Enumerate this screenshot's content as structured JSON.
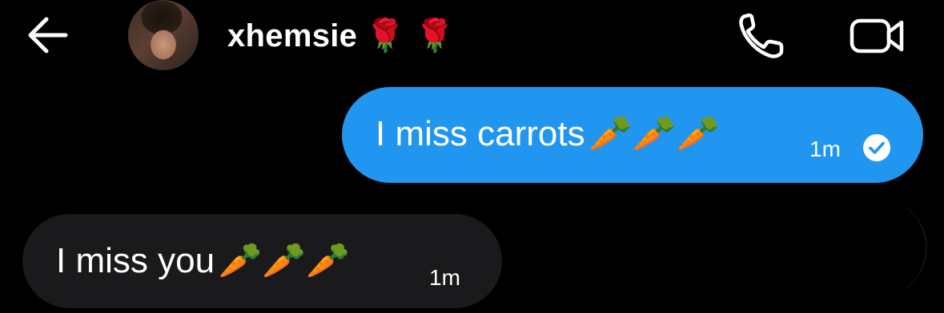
{
  "header": {
    "contact_name": "xhemsie",
    "name_emojis": "🌹🌹"
  },
  "messages": [
    {
      "direction": "sent",
      "text": "I miss carrots",
      "emojis": "🥕🥕🥕",
      "time": "1m",
      "status": "read"
    },
    {
      "direction": "received",
      "text": "I miss you",
      "emojis": "🥕🥕🥕",
      "time": "1m"
    }
  ],
  "colors": {
    "background": "#000000",
    "sent_bubble": "#2196f0",
    "received_bubble": "#1a1a1c",
    "text": "#ffffff"
  },
  "icons": [
    "back-arrow-icon",
    "phone-icon",
    "video-camera-icon",
    "read-check-icon"
  ]
}
